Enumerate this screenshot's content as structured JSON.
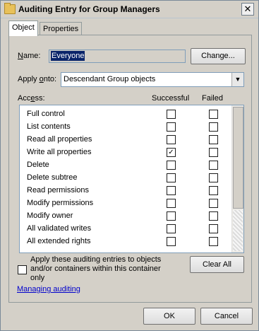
{
  "window": {
    "title": "Auditing Entry for Group Managers",
    "close_glyph": "✕"
  },
  "tabs": [
    {
      "label": "Object"
    },
    {
      "label": "Properties"
    }
  ],
  "name": {
    "label_prefix": "N",
    "label_rest": "ame:",
    "value": "Everyone",
    "change_button": "Change..."
  },
  "apply_onto": {
    "label_pre": "Apply ",
    "label_u": "o",
    "label_post": "nto:",
    "value": "Descendant Group objects",
    "arrow": "▼"
  },
  "access": {
    "label_pre": "Acc",
    "label_u": "e",
    "label_post": "ss:",
    "col_successful": "Successful",
    "col_failed": "Failed",
    "check_glyph": "✓",
    "rows": [
      {
        "name": "Full control",
        "successful": false,
        "failed": false
      },
      {
        "name": "List contents",
        "successful": false,
        "failed": false
      },
      {
        "name": "Read all properties",
        "successful": false,
        "failed": false
      },
      {
        "name": "Write all properties",
        "successful": true,
        "failed": false
      },
      {
        "name": "Delete",
        "successful": false,
        "failed": false
      },
      {
        "name": "Delete subtree",
        "successful": false,
        "failed": false
      },
      {
        "name": "Read permissions",
        "successful": false,
        "failed": false
      },
      {
        "name": "Modify permissions",
        "successful": false,
        "failed": false
      },
      {
        "name": "Modify owner",
        "successful": false,
        "failed": false
      },
      {
        "name": "All validated writes",
        "successful": false,
        "failed": false
      },
      {
        "name": "All extended rights",
        "successful": false,
        "failed": false
      }
    ]
  },
  "apply_checkbox": {
    "text": "Apply these auditing entries to objects and/or containers within this container only",
    "checked": false
  },
  "clear_all_button": "Clear All",
  "help_link": "Managing auditing",
  "buttons": {
    "ok": "OK",
    "cancel": "Cancel"
  }
}
